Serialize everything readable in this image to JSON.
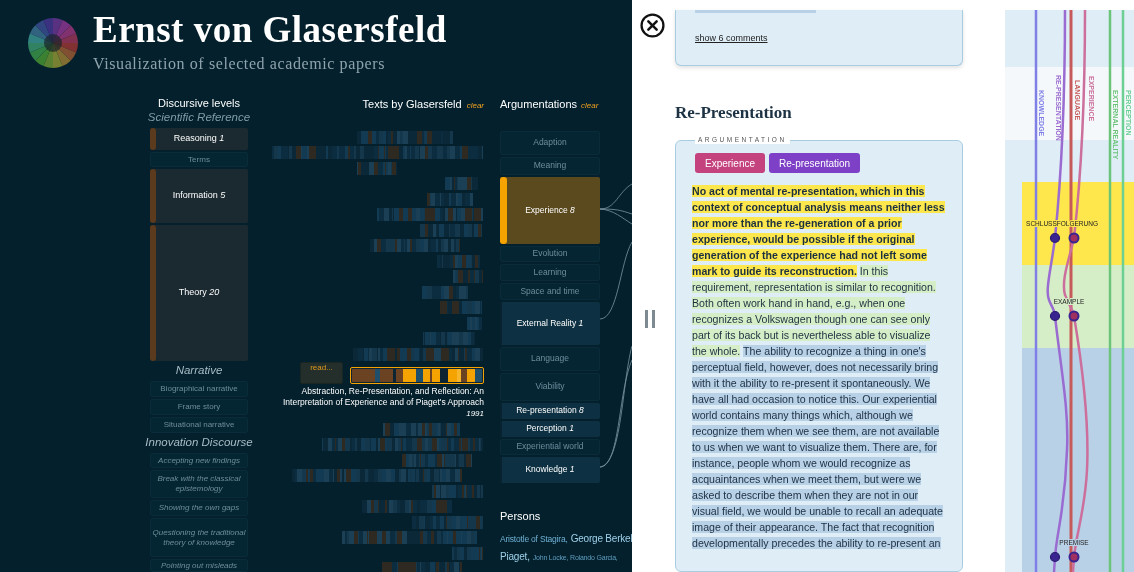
{
  "header": {
    "title": "Ernst von Glasersfeld",
    "subtitle": "Visualization of selected academic papers"
  },
  "discursive_levels": {
    "heading": "Discursive levels",
    "groups": [
      {
        "title": "Scientific Reference",
        "italic_items": false,
        "items": [
          {
            "label": "Reasoning",
            "count": "1",
            "active": true
          },
          {
            "label": "Terms",
            "active": false
          },
          {
            "label": "Information",
            "count": "5",
            "active": true
          },
          {
            "label": "Theory",
            "count": "20",
            "active": true
          }
        ]
      },
      {
        "title": "Narrative",
        "italic_items": false,
        "items": [
          {
            "label": "Biographical narrative",
            "active": false
          },
          {
            "label": "Frame story",
            "active": false
          },
          {
            "label": "Situational narrative",
            "active": false
          }
        ]
      },
      {
        "title": "Innovation Discourse",
        "italic_items": true,
        "items": [
          {
            "label": "Accepting new findings",
            "active": false
          },
          {
            "label": "Break with the classical epistemology",
            "active": false
          },
          {
            "label": "Showing the own gaps",
            "active": false
          },
          {
            "label": "Questioning the traditional theory of knowledge",
            "active": false
          },
          {
            "label": "Pointing out misleads",
            "active": false
          }
        ]
      }
    ]
  },
  "texts": {
    "heading": "Texts by Glasersfeld",
    "clear": "clear",
    "selected_paper": {
      "read_button": "read...",
      "title": "Abstraction, Re-Presentation, and Reflection: An Interpretation of Experience and of Piaget's Approach",
      "year": "1991"
    }
  },
  "argumentations": {
    "heading": "Argumentations",
    "clear": "clear",
    "items": [
      {
        "label": "Adaption",
        "active": false,
        "selected": false
      },
      {
        "label": "Meaning",
        "active": false,
        "selected": false
      },
      {
        "label": "Experience",
        "count": "8",
        "active": true,
        "selected": true
      },
      {
        "label": "Evolution",
        "active": false,
        "selected": false
      },
      {
        "label": "Learning",
        "active": false,
        "selected": false
      },
      {
        "label": "Space and time",
        "active": false,
        "selected": false
      },
      {
        "label": "External Reality",
        "count": "1",
        "active": true,
        "selected": false
      },
      {
        "label": "Language",
        "active": false,
        "selected": false
      },
      {
        "label": "Viability",
        "active": false,
        "selected": false
      },
      {
        "label": "Re-presentation",
        "count": "8",
        "active": true,
        "selected": false
      },
      {
        "label": "Perception",
        "count": "1",
        "active": true,
        "selected": false
      },
      {
        "label": "Experiential world",
        "active": false,
        "selected": false
      },
      {
        "label": "Knowledge",
        "count": "1",
        "active": true,
        "selected": false
      }
    ]
  },
  "persons": {
    "heading": "Persons",
    "rows": [
      {
        "names": [
          {
            "name": "Aristotle of Stagira,",
            "kind": "small"
          },
          {
            "name": "George Berkel",
            "kind": "large"
          }
        ]
      },
      {
        "names": [
          {
            "name": "Piaget,",
            "kind": "large"
          },
          {
            "name": "John Locke, Rolando Garcia,",
            "kind": "tiny"
          }
        ]
      }
    ]
  },
  "reader": {
    "previous_card": {
      "link": "show 6 comments"
    },
    "section_title": "Re-Presentation",
    "card": {
      "legend": "ARGUMENTATION",
      "tags": [
        {
          "label": "Experience",
          "color": "#c4427e"
        },
        {
          "label": "Re-presentation",
          "color": "#7d40c6"
        }
      ],
      "segments": [
        {
          "kind": "conclusion",
          "text": "No act of mental re-presentation, which in this context of conceptual analysis means neither less nor more than the re-generation of a prior experience, would be possible if the original generation of the experience had not left some mark to guide its reconstruction."
        },
        {
          "kind": "example",
          "text": "In this requirement, representation is similar to recognition. Both often work hand in hand, e.g., when one recognizes a Volkswagen though one can see only part of its back but is nevertheless able to visualize the whole."
        },
        {
          "kind": "premise",
          "text": "The ability to recognize a thing in one's perceptual field, however, does not necessarily bring with it the ability to re-present it spontaneously. We have all had occasion to notice this. Our experiential world contains many things which, although we recognize them when we see them, are not available to us when we want to visualize them. There are, for instance, people whom we would recognize as acquaintances when we meet them, but were we asked to describe them when they are not in our visual field, we would be unable to recall an adequate image of their appearance. The fact that recognition developmentally precedes the ability to re-present an"
        }
      ]
    }
  },
  "flow": {
    "lines": [
      {
        "label": "KNOWLEDGE",
        "color": "#7f7fe6"
      },
      {
        "label": "RE-PRESENTATION",
        "color": "#9a6bd0"
      },
      {
        "label": "LANGUAGE",
        "color": "#c65a5a"
      },
      {
        "label": "EXPERIENCE",
        "color": "#cc6f9c"
      },
      {
        "label": "EXTERNAL REALITY",
        "color": "#6cc47a"
      },
      {
        "label": "PERCEPTION",
        "color": "#6ccf94"
      }
    ],
    "sections": [
      {
        "label": "SCHLUSSFOLGERUNG",
        "kind": "conclusion"
      },
      {
        "label": "EXAMPLE",
        "kind": "example"
      },
      {
        "label": "PREMISE",
        "kind": "premise"
      }
    ]
  }
}
